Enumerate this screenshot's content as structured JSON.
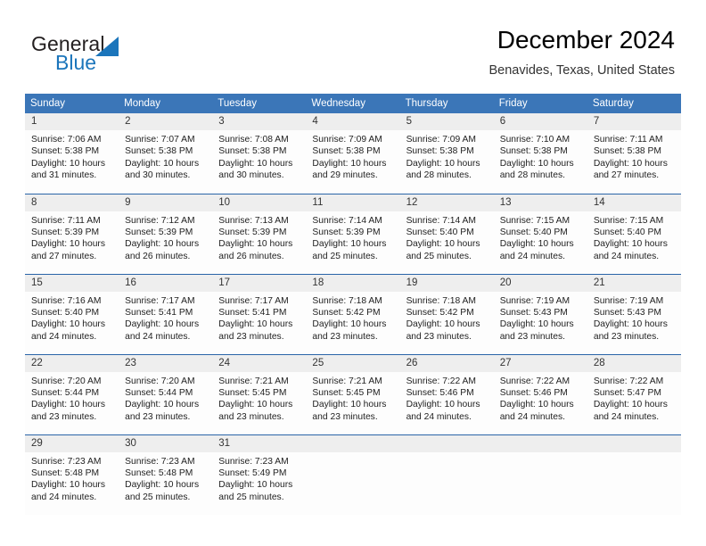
{
  "brand": {
    "name_part1": "General",
    "name_part2": "Blue",
    "triangle_color": "#1b75bb",
    "text_color": "#231f20"
  },
  "header": {
    "title": "December 2024",
    "subtitle": "Benavides, Texas, United States",
    "accent_color": "#3b76b8",
    "row_divider_color": "#2a64a8",
    "daynum_bg": "#eeeeee"
  },
  "weekday_headers": [
    "Sunday",
    "Monday",
    "Tuesday",
    "Wednesday",
    "Thursday",
    "Friday",
    "Saturday"
  ],
  "weeks": [
    [
      {
        "day": "1",
        "sunrise": "Sunrise: 7:06 AM",
        "sunset": "Sunset: 5:38 PM",
        "daylight1": "Daylight: 10 hours",
        "daylight2": "and 31 minutes."
      },
      {
        "day": "2",
        "sunrise": "Sunrise: 7:07 AM",
        "sunset": "Sunset: 5:38 PM",
        "daylight1": "Daylight: 10 hours",
        "daylight2": "and 30 minutes."
      },
      {
        "day": "3",
        "sunrise": "Sunrise: 7:08 AM",
        "sunset": "Sunset: 5:38 PM",
        "daylight1": "Daylight: 10 hours",
        "daylight2": "and 30 minutes."
      },
      {
        "day": "4",
        "sunrise": "Sunrise: 7:09 AM",
        "sunset": "Sunset: 5:38 PM",
        "daylight1": "Daylight: 10 hours",
        "daylight2": "and 29 minutes."
      },
      {
        "day": "5",
        "sunrise": "Sunrise: 7:09 AM",
        "sunset": "Sunset: 5:38 PM",
        "daylight1": "Daylight: 10 hours",
        "daylight2": "and 28 minutes."
      },
      {
        "day": "6",
        "sunrise": "Sunrise: 7:10 AM",
        "sunset": "Sunset: 5:38 PM",
        "daylight1": "Daylight: 10 hours",
        "daylight2": "and 28 minutes."
      },
      {
        "day": "7",
        "sunrise": "Sunrise: 7:11 AM",
        "sunset": "Sunset: 5:38 PM",
        "daylight1": "Daylight: 10 hours",
        "daylight2": "and 27 minutes."
      }
    ],
    [
      {
        "day": "8",
        "sunrise": "Sunrise: 7:11 AM",
        "sunset": "Sunset: 5:39 PM",
        "daylight1": "Daylight: 10 hours",
        "daylight2": "and 27 minutes."
      },
      {
        "day": "9",
        "sunrise": "Sunrise: 7:12 AM",
        "sunset": "Sunset: 5:39 PM",
        "daylight1": "Daylight: 10 hours",
        "daylight2": "and 26 minutes."
      },
      {
        "day": "10",
        "sunrise": "Sunrise: 7:13 AM",
        "sunset": "Sunset: 5:39 PM",
        "daylight1": "Daylight: 10 hours",
        "daylight2": "and 26 minutes."
      },
      {
        "day": "11",
        "sunrise": "Sunrise: 7:14 AM",
        "sunset": "Sunset: 5:39 PM",
        "daylight1": "Daylight: 10 hours",
        "daylight2": "and 25 minutes."
      },
      {
        "day": "12",
        "sunrise": "Sunrise: 7:14 AM",
        "sunset": "Sunset: 5:40 PM",
        "daylight1": "Daylight: 10 hours",
        "daylight2": "and 25 minutes."
      },
      {
        "day": "13",
        "sunrise": "Sunrise: 7:15 AM",
        "sunset": "Sunset: 5:40 PM",
        "daylight1": "Daylight: 10 hours",
        "daylight2": "and 24 minutes."
      },
      {
        "day": "14",
        "sunrise": "Sunrise: 7:15 AM",
        "sunset": "Sunset: 5:40 PM",
        "daylight1": "Daylight: 10 hours",
        "daylight2": "and 24 minutes."
      }
    ],
    [
      {
        "day": "15",
        "sunrise": "Sunrise: 7:16 AM",
        "sunset": "Sunset: 5:40 PM",
        "daylight1": "Daylight: 10 hours",
        "daylight2": "and 24 minutes."
      },
      {
        "day": "16",
        "sunrise": "Sunrise: 7:17 AM",
        "sunset": "Sunset: 5:41 PM",
        "daylight1": "Daylight: 10 hours",
        "daylight2": "and 24 minutes."
      },
      {
        "day": "17",
        "sunrise": "Sunrise: 7:17 AM",
        "sunset": "Sunset: 5:41 PM",
        "daylight1": "Daylight: 10 hours",
        "daylight2": "and 23 minutes."
      },
      {
        "day": "18",
        "sunrise": "Sunrise: 7:18 AM",
        "sunset": "Sunset: 5:42 PM",
        "daylight1": "Daylight: 10 hours",
        "daylight2": "and 23 minutes."
      },
      {
        "day": "19",
        "sunrise": "Sunrise: 7:18 AM",
        "sunset": "Sunset: 5:42 PM",
        "daylight1": "Daylight: 10 hours",
        "daylight2": "and 23 minutes."
      },
      {
        "day": "20",
        "sunrise": "Sunrise: 7:19 AM",
        "sunset": "Sunset: 5:43 PM",
        "daylight1": "Daylight: 10 hours",
        "daylight2": "and 23 minutes."
      },
      {
        "day": "21",
        "sunrise": "Sunrise: 7:19 AM",
        "sunset": "Sunset: 5:43 PM",
        "daylight1": "Daylight: 10 hours",
        "daylight2": "and 23 minutes."
      }
    ],
    [
      {
        "day": "22",
        "sunrise": "Sunrise: 7:20 AM",
        "sunset": "Sunset: 5:44 PM",
        "daylight1": "Daylight: 10 hours",
        "daylight2": "and 23 minutes."
      },
      {
        "day": "23",
        "sunrise": "Sunrise: 7:20 AM",
        "sunset": "Sunset: 5:44 PM",
        "daylight1": "Daylight: 10 hours",
        "daylight2": "and 23 minutes."
      },
      {
        "day": "24",
        "sunrise": "Sunrise: 7:21 AM",
        "sunset": "Sunset: 5:45 PM",
        "daylight1": "Daylight: 10 hours",
        "daylight2": "and 23 minutes."
      },
      {
        "day": "25",
        "sunrise": "Sunrise: 7:21 AM",
        "sunset": "Sunset: 5:45 PM",
        "daylight1": "Daylight: 10 hours",
        "daylight2": "and 23 minutes."
      },
      {
        "day": "26",
        "sunrise": "Sunrise: 7:22 AM",
        "sunset": "Sunset: 5:46 PM",
        "daylight1": "Daylight: 10 hours",
        "daylight2": "and 24 minutes."
      },
      {
        "day": "27",
        "sunrise": "Sunrise: 7:22 AM",
        "sunset": "Sunset: 5:46 PM",
        "daylight1": "Daylight: 10 hours",
        "daylight2": "and 24 minutes."
      },
      {
        "day": "28",
        "sunrise": "Sunrise: 7:22 AM",
        "sunset": "Sunset: 5:47 PM",
        "daylight1": "Daylight: 10 hours",
        "daylight2": "and 24 minutes."
      }
    ],
    [
      {
        "day": "29",
        "sunrise": "Sunrise: 7:23 AM",
        "sunset": "Sunset: 5:48 PM",
        "daylight1": "Daylight: 10 hours",
        "daylight2": "and 24 minutes."
      },
      {
        "day": "30",
        "sunrise": "Sunrise: 7:23 AM",
        "sunset": "Sunset: 5:48 PM",
        "daylight1": "Daylight: 10 hours",
        "daylight2": "and 25 minutes."
      },
      {
        "day": "31",
        "sunrise": "Sunrise: 7:23 AM",
        "sunset": "Sunset: 5:49 PM",
        "daylight1": "Daylight: 10 hours",
        "daylight2": "and 25 minutes."
      },
      {
        "day": "",
        "sunrise": "",
        "sunset": "",
        "daylight1": "",
        "daylight2": ""
      },
      {
        "day": "",
        "sunrise": "",
        "sunset": "",
        "daylight1": "",
        "daylight2": ""
      },
      {
        "day": "",
        "sunrise": "",
        "sunset": "",
        "daylight1": "",
        "daylight2": ""
      },
      {
        "day": "",
        "sunrise": "",
        "sunset": "",
        "daylight1": "",
        "daylight2": ""
      }
    ]
  ]
}
